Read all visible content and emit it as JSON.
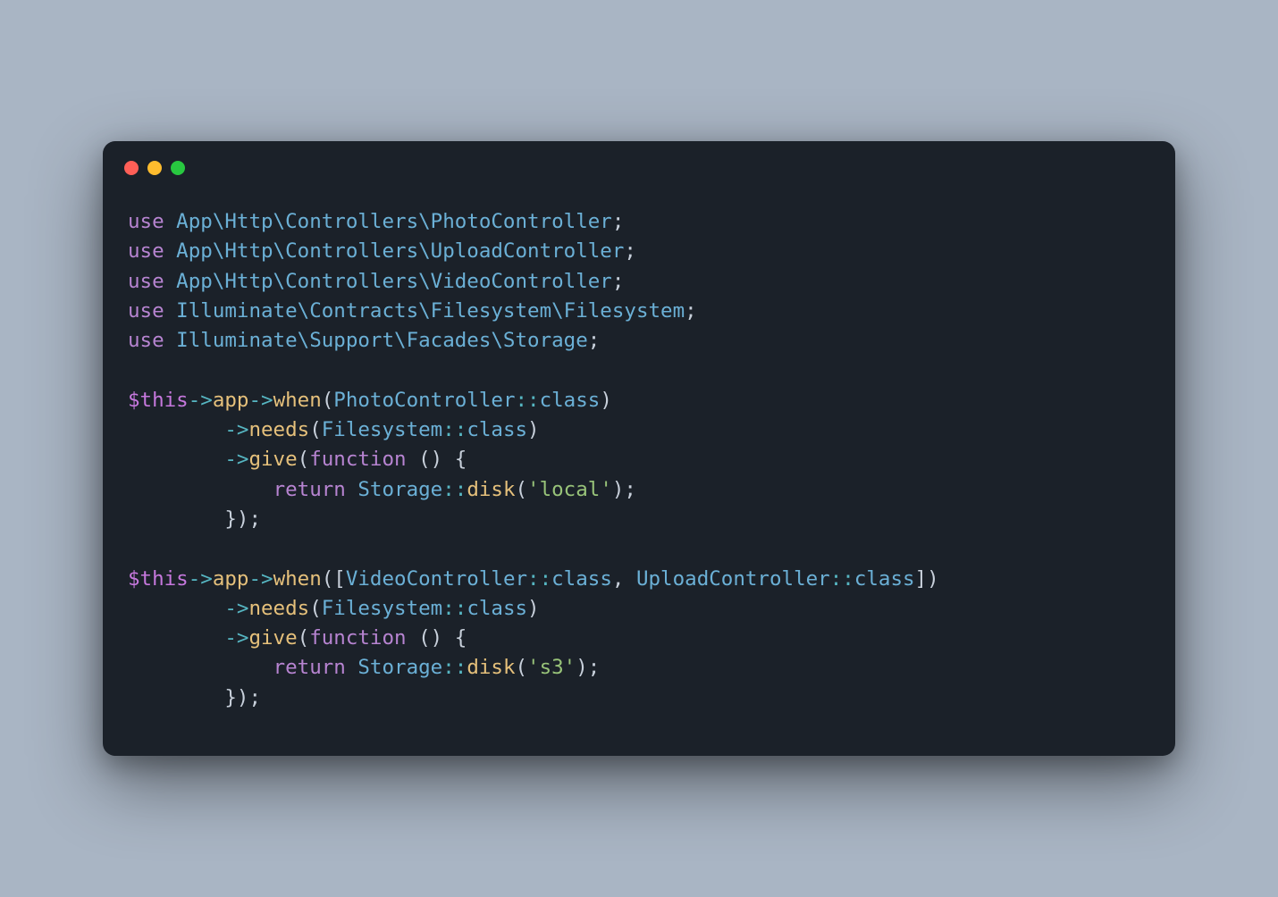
{
  "traffic_lights": {
    "red": "#ff5f57",
    "yellow": "#febc2e",
    "green": "#28c840"
  },
  "code": {
    "use1_kw": "use",
    "use1_ns": " App\\Http\\Controllers\\PhotoController",
    "use2_kw": "use",
    "use2_ns": " App\\Http\\Controllers\\UploadController",
    "use3_kw": "use",
    "use3_ns": " App\\Http\\Controllers\\VideoController",
    "use4_kw": "use",
    "use4_ns": " Illuminate\\Contracts\\Filesystem\\Filesystem",
    "use5_kw": "use",
    "use5_ns": " Illuminate\\Support\\Facades\\Storage",
    "semicolon": ";",
    "this": "$this",
    "arrow": "->",
    "app": "app",
    "when": "when",
    "needs": "needs",
    "give": "give",
    "lparen": "(",
    "rparen": ")",
    "lbrack": "[",
    "rbrack": "]",
    "lbrace": "{",
    "rbrace": "}",
    "comma": ", ",
    "dcolon": "::",
    "class_kw": "class",
    "PhotoController": "PhotoController",
    "VideoController": "VideoController",
    "UploadController": "UploadController",
    "Filesystem": "Filesystem",
    "Storage": "Storage",
    "function_kw": "function",
    "space": " ",
    "return_kw": "return",
    "disk": "disk",
    "str_local": "'local'",
    "str_s3": "'s3'",
    "indent1": "        ",
    "indent2": "            ",
    "indent_rbrace": "        ",
    "close_paren_semi": ");",
    "close_brace_paren_semi": "});"
  }
}
